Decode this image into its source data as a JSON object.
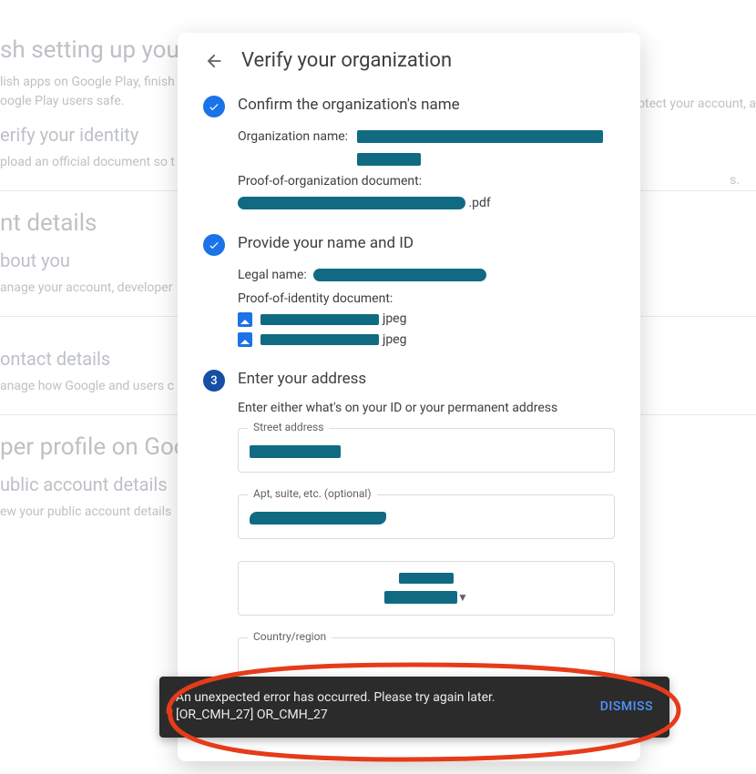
{
  "background": {
    "heading1": "sh setting up your",
    "text1a": "lish apps on Google Play, finish",
    "text1b": "oogle Play users safe.",
    "heading2": "erify your identity",
    "text2": "pload an official document so t",
    "heading3": "nt details",
    "sub3": "bout you",
    "text3": "anage your account, developer",
    "heading4": "ontact details",
    "text4": "anage how Google and users c",
    "heading5": "per profile on Goo",
    "sub5": "ublic account details",
    "text5": "ew your public account details",
    "right1": "otect your account, a",
    "right2": "s."
  },
  "dialog": {
    "title": "Verify your organization",
    "step1": {
      "title": "Confirm the organization's name",
      "org_name_label": "Organization name:",
      "proof_label": "Proof-of-organization document:",
      "file_ext": ".pdf"
    },
    "step2": {
      "title": "Provide your name and ID",
      "legal_name_label": "Legal name:",
      "proof_label": "Proof-of-identity document:",
      "file1_ext": "jpeg",
      "file2_ext": "jpeg"
    },
    "step3": {
      "number": "3",
      "title": "Enter your address",
      "help": "Enter either what's on your ID or your permanent address",
      "street_label": "Street address",
      "apt_label": "Apt, suite, etc. (optional)",
      "country_label": "Country/region"
    }
  },
  "snackbar": {
    "line1": "An unexpected error has occurred. Please try again later.",
    "line2": "[OR_CMH_27] OR_CMH_27",
    "action": "DISMISS"
  }
}
